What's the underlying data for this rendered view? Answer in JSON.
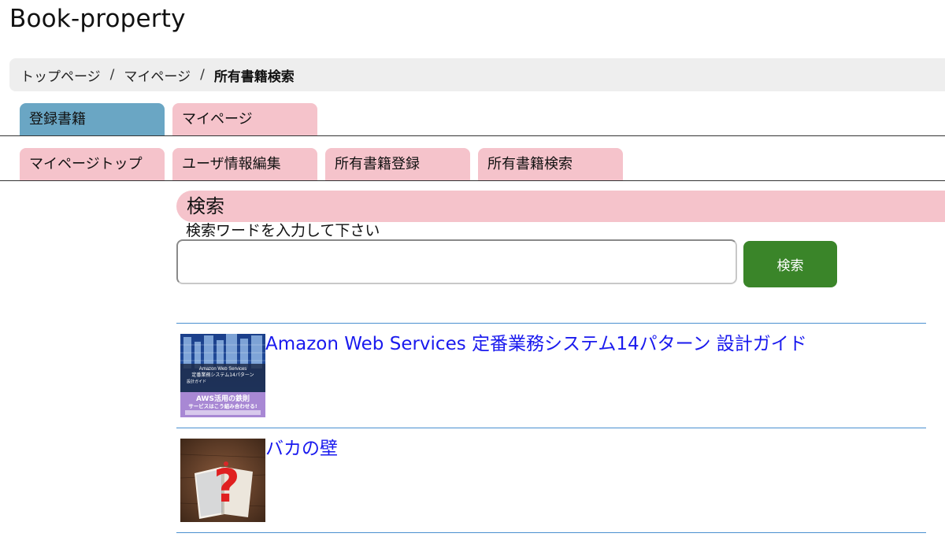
{
  "site": {
    "title": "Book-property"
  },
  "breadcrumb": {
    "items": [
      "トップページ",
      "マイページ",
      "所有書籍検索"
    ],
    "separator": "/"
  },
  "nav": {
    "primary_tabs": [
      {
        "label": "登録書籍",
        "active": true
      },
      {
        "label": "マイページ",
        "active": false
      }
    ],
    "secondary_tabs": [
      {
        "label": "マイページトップ"
      },
      {
        "label": "ユーザ情報編集"
      },
      {
        "label": "所有書籍登録"
      },
      {
        "label": "所有書籍検索"
      }
    ]
  },
  "search": {
    "header": "検索",
    "label": "検索ワードを入力して下さい",
    "value": "",
    "placeholder": "",
    "button_label": "検索"
  },
  "results": [
    {
      "title": "Amazon Web Services 定番業務システム14パターン 設計ガイド",
      "cover_icon": "aws-book-cover-image",
      "cover_text": {
        "line1": "Amazon Web Services",
        "line2": "定番業務システム14パターン",
        "line3": "設計ガイド",
        "band1": "AWS活用の鉄則",
        "band2": "サービスはこう組み合わせる!"
      }
    },
    {
      "title": "バカの壁",
      "cover_icon": "unknown-book-placeholder-image",
      "cover_text": {
        "mark": "?"
      }
    }
  ],
  "colors": {
    "tab_pink": "#f5c3cb",
    "tab_active_blue": "#6aa6c4",
    "button_green": "#3a8529",
    "link_blue": "#1a1aee",
    "divider_blue": "#4a90d0",
    "breadcrumb_bg": "#eeeeee"
  }
}
